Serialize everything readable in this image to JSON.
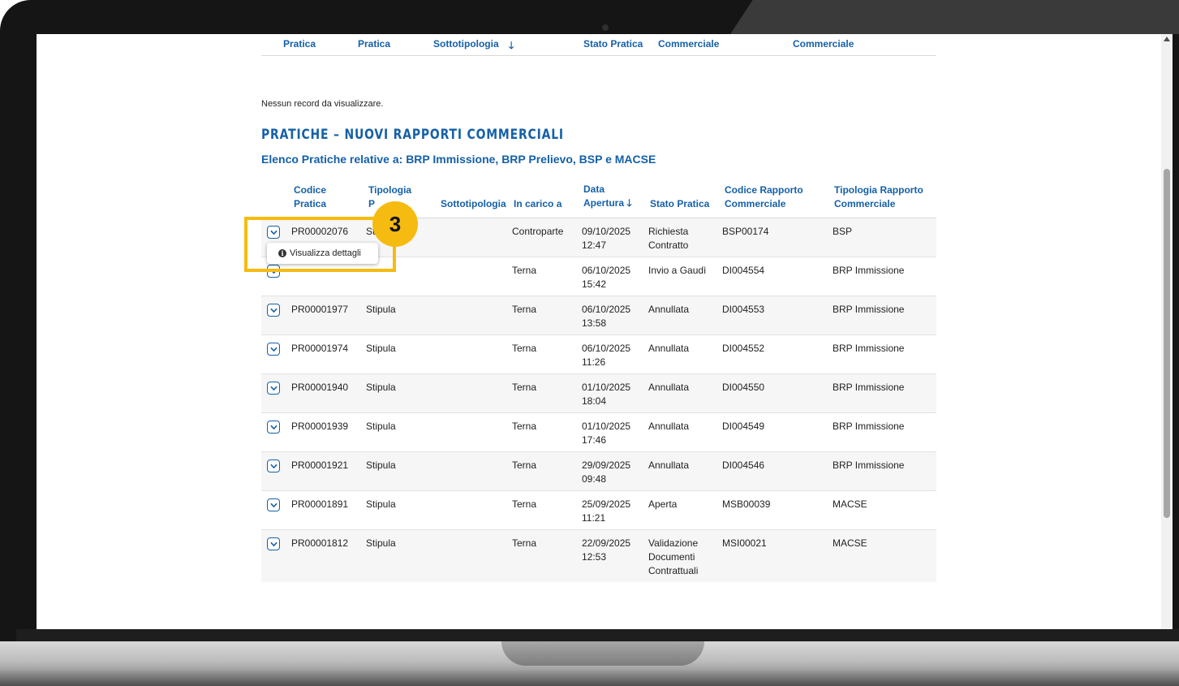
{
  "top_header": {
    "cols": [
      "Pratica",
      "Pratica",
      "Sottotipologia",
      "🡓",
      "Stato Pratica",
      "Commerciale",
      "Commerciale"
    ]
  },
  "no_record_text": "Nessun record da visualizzare.",
  "section_title": "PRATICHE – NUOVI RAPPORTI COMMERCIALI",
  "section_subtitle": "Elenco Pratiche relative a: BRP Immissione, BRP Prelievo, BSP e MACSE",
  "table": {
    "headers": {
      "codice_1": "Codice",
      "codice_2": "Pratica",
      "tipologia_1": "Tipologia",
      "tipologia_2": "P",
      "sottotipologia": "Sottotipologia",
      "in_carico": "In carico a",
      "data_1": "Data",
      "data_2": "Apertura",
      "data_sort": "🡓",
      "stato": "Stato Pratica",
      "codice_rapporto_1": "Codice Rapporto",
      "codice_rapporto_2": "Commerciale",
      "tipologia_rapporto_1": "Tipologia Rapporto",
      "tipologia_rapporto_2": "Commerciale"
    },
    "rows": [
      {
        "codice": "PR00002076",
        "tipologia": "Sti",
        "in_carico": "Controparte",
        "data": "09/10/2025",
        "ora": "12:47",
        "stato_1": "Richiesta",
        "stato_2": "Contratto",
        "stato_3": "",
        "rapporto": "BSP00174",
        "tipologia_rapporto": "BSP"
      },
      {
        "codice": "",
        "tipologia": "",
        "in_carico": "Terna",
        "data": "06/10/2025",
        "ora": "15:42",
        "stato_1": "Invio a Gaudì",
        "stato_2": "",
        "stato_3": "",
        "rapporto": "DI004554",
        "tipologia_rapporto": "BRP Immissione"
      },
      {
        "codice": "PR00001977",
        "tipologia": "Stipula",
        "in_carico": "Terna",
        "data": "06/10/2025",
        "ora": "13:58",
        "stato_1": "Annullata",
        "stato_2": "",
        "stato_3": "",
        "rapporto": "DI004553",
        "tipologia_rapporto": "BRP Immissione"
      },
      {
        "codice": "PR00001974",
        "tipologia": "Stipula",
        "in_carico": "Terna",
        "data": "06/10/2025",
        "ora": "11:26",
        "stato_1": "Annullata",
        "stato_2": "",
        "stato_3": "",
        "rapporto": "DI004552",
        "tipologia_rapporto": "BRP Immissione"
      },
      {
        "codice": "PR00001940",
        "tipologia": "Stipula",
        "in_carico": "Terna",
        "data": "01/10/2025",
        "ora": "18:04",
        "stato_1": "Annullata",
        "stato_2": "",
        "stato_3": "",
        "rapporto": "DI004550",
        "tipologia_rapporto": "BRP Immissione"
      },
      {
        "codice": "PR00001939",
        "tipologia": "Stipula",
        "in_carico": "Terna",
        "data": "01/10/2025",
        "ora": "17:46",
        "stato_1": "Annullata",
        "stato_2": "",
        "stato_3": "",
        "rapporto": "DI004549",
        "tipologia_rapporto": "BRP Immissione"
      },
      {
        "codice": "PR00001921",
        "tipologia": "Stipula",
        "in_carico": "Terna",
        "data": "29/09/2025",
        "ora": "09:48",
        "stato_1": "Annullata",
        "stato_2": "",
        "stato_3": "",
        "rapporto": "DI004546",
        "tipologia_rapporto": "BRP Immissione"
      },
      {
        "codice": "PR00001891",
        "tipologia": "Stipula",
        "in_carico": "Terna",
        "data": "25/09/2025",
        "ora": "11:21",
        "stato_1": "Aperta",
        "stato_2": "",
        "stato_3": "",
        "rapporto": "MSB00039",
        "tipologia_rapporto": "MACSE"
      },
      {
        "codice": "PR00001812",
        "tipologia": "Stipula",
        "in_carico": "Terna",
        "data": "22/09/2025",
        "ora": "12:53",
        "stato_1": "Validazione",
        "stato_2": "Documenti",
        "stato_3": "Contrattuali",
        "rapporto": "MSI00021",
        "tipologia_rapporto": "MACSE"
      }
    ]
  },
  "tooltip": {
    "icon": "info-icon",
    "label": "Visualizza dettagli"
  },
  "step_badge": "3",
  "colors": {
    "accent_blue": "#1560a8",
    "highlight_yellow": "#f6bb10"
  }
}
